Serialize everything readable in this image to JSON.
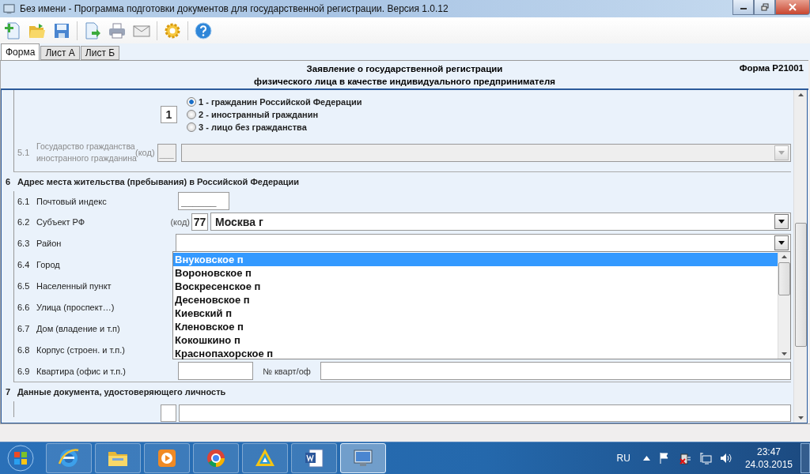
{
  "window": {
    "title": "Без имени - Программа подготовки документов для государственной регистрации. Версия 1.0.12"
  },
  "tabs": [
    {
      "label": "Форма",
      "selected": true
    },
    {
      "label": "Лист А",
      "selected": false
    },
    {
      "label": "Лист Б",
      "selected": false
    }
  ],
  "form": {
    "title_lines": [
      "Заявление о государственной регистрации",
      "физического лица в качестве индивидуального предпринимателя"
    ],
    "form_code": "Форма Р21001"
  },
  "citizenship": {
    "code": "1",
    "options": [
      {
        "label": "1 - гражданин Российской Федерации",
        "selected": true
      },
      {
        "label": "2 - иностранный гражданин",
        "selected": false
      },
      {
        "label": "3 - лицо без гражданства",
        "selected": false
      }
    ]
  },
  "field_5_1": {
    "number": "5.1",
    "label_lines": [
      "Государство гражданства",
      "иностранного гражданина"
    ],
    "code_label": "(код)",
    "code_placeholder": "___",
    "disabled": true
  },
  "section_6": {
    "number": "6",
    "title": "Адрес места жительства (пребывания) в Российской Федерации",
    "rows": [
      {
        "number": "6.1",
        "label": "Почтовый индекс",
        "kind": "index",
        "placeholder": "______"
      },
      {
        "number": "6.2",
        "label": "Субъект РФ",
        "kind": "coded_combo",
        "code_label": "(код)",
        "code": "77",
        "value": "Москва г"
      },
      {
        "number": "6.3",
        "label": "Район",
        "kind": "combo",
        "open": true
      },
      {
        "number": "6.4",
        "label": "Город",
        "kind": "text"
      },
      {
        "number": "6.5",
        "label": "Населенный пункт",
        "kind": "text"
      },
      {
        "number": "6.6",
        "label": "Улица (проспект…)",
        "kind": "text"
      },
      {
        "number": "6.7",
        "label": "Дом (владение и т.п)",
        "kind": "text"
      },
      {
        "number": "6.8",
        "label": "Корпус (строен. и т.п.)",
        "kind": "text"
      },
      {
        "number": "6.9",
        "label": "Квартира (офис и т.п.)",
        "kind": "apartment",
        "middle_label": "№ кварт/оф"
      }
    ]
  },
  "dropdown": {
    "items": [
      {
        "label": "Внуковское п",
        "selected": true
      },
      {
        "label": "Вороновское п",
        "selected": false
      },
      {
        "label": "Воскресенское п",
        "selected": false
      },
      {
        "label": "Десеновское п",
        "selected": false
      },
      {
        "label": "Киевский п",
        "selected": false
      },
      {
        "label": "Кленовское п",
        "selected": false
      },
      {
        "label": "Кокошкино п",
        "selected": false
      },
      {
        "label": "Краснопахорское п",
        "selected": false
      }
    ]
  },
  "section_7": {
    "number": "7",
    "title": "Данные документа, удостоверяющего личность"
  },
  "taskbar": {
    "apps": [
      {
        "kind": "ie",
        "active": false
      },
      {
        "kind": "folder",
        "active": false
      },
      {
        "kind": "media",
        "active": false
      },
      {
        "kind": "chrome",
        "active": false
      },
      {
        "kind": "triangle",
        "active": false
      },
      {
        "kind": "word",
        "active": false
      },
      {
        "kind": "monitor",
        "active": true
      }
    ],
    "language": "RU",
    "time": "23:47",
    "date": "24.03.2015"
  }
}
